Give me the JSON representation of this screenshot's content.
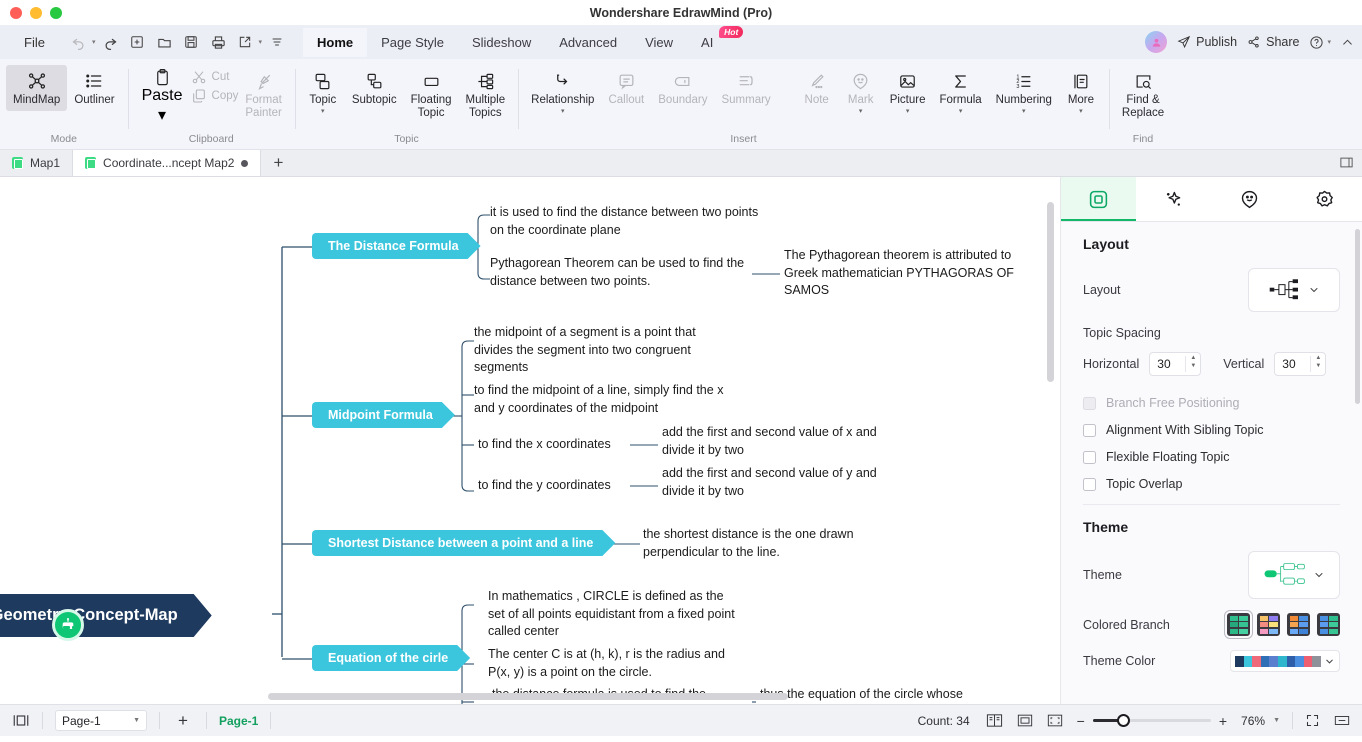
{
  "window": {
    "title": "Wondershare EdrawMind (Pro)",
    "traffic_lights": [
      "close",
      "minimize",
      "maximize"
    ]
  },
  "menubar": {
    "file_label": "File",
    "quick_access": [
      {
        "name": "undo-icon",
        "disabled": true
      },
      {
        "name": "redo-icon",
        "disabled": false
      },
      {
        "name": "new-icon",
        "disabled": false
      },
      {
        "name": "open-icon",
        "disabled": false
      },
      {
        "name": "save-icon",
        "disabled": false
      },
      {
        "name": "print-icon",
        "disabled": false
      },
      {
        "name": "export-icon",
        "disabled": false
      }
    ],
    "tabs": [
      {
        "label": "Home",
        "active": true
      },
      {
        "label": "Page Style",
        "active": false
      },
      {
        "label": "Slideshow",
        "active": false
      },
      {
        "label": "Advanced",
        "active": false
      },
      {
        "label": "View",
        "active": false
      },
      {
        "label": "AI",
        "active": false,
        "badge": "Hot"
      }
    ],
    "right": {
      "publish_label": "Publish",
      "share_label": "Share",
      "help_icon": "question-circle-icon",
      "collapse_icon": "chevron-up-icon"
    }
  },
  "ribbon": {
    "groups": [
      {
        "label": "Mode",
        "items": [
          {
            "label": "MindMap",
            "icon": "mindmap-icon",
            "selected": true,
            "disabled": false
          },
          {
            "label": "Outliner",
            "icon": "outliner-icon",
            "selected": false,
            "disabled": false
          }
        ]
      },
      {
        "label": "Clipboard",
        "items": [
          {
            "label": "Paste",
            "icon": "paste-icon",
            "dropdown": true,
            "disabled": false
          },
          {
            "label": "Cut",
            "icon": "scissors-icon",
            "disabled": true
          },
          {
            "label": "Copy",
            "icon": "copy-icon",
            "disabled": true
          },
          {
            "label": "Format\nPainter",
            "icon": "format-painter-icon",
            "disabled": true
          }
        ]
      },
      {
        "label": "Topic",
        "items": [
          {
            "label": "Topic",
            "icon": "topic-icon",
            "dropdown": true,
            "disabled": false
          },
          {
            "label": "Subtopic",
            "icon": "subtopic-icon",
            "disabled": false
          },
          {
            "label": "Floating\nTopic",
            "icon": "floating-topic-icon",
            "disabled": false
          },
          {
            "label": "Multiple\nTopics",
            "icon": "multiple-topics-icon",
            "disabled": false
          }
        ]
      },
      {
        "label": "Insert",
        "items": [
          {
            "label": "Relationship",
            "icon": "relationship-icon",
            "dropdown": true,
            "disabled": false
          },
          {
            "label": "Callout",
            "icon": "callout-icon",
            "disabled": true
          },
          {
            "label": "Boundary",
            "icon": "boundary-icon",
            "disabled": true
          },
          {
            "label": "Summary",
            "icon": "summary-icon",
            "disabled": true
          },
          {
            "label": "Note",
            "icon": "note-icon",
            "disabled": true
          },
          {
            "label": "Mark",
            "icon": "mark-icon",
            "dropdown": true,
            "disabled": true
          },
          {
            "label": "Picture",
            "icon": "picture-icon",
            "dropdown": true,
            "disabled": false
          },
          {
            "label": "Formula",
            "icon": "formula-icon",
            "dropdown": true,
            "disabled": false
          },
          {
            "label": "Numbering",
            "icon": "numbering-icon",
            "dropdown": true,
            "disabled": false
          },
          {
            "label": "More",
            "icon": "more-icon",
            "dropdown": true,
            "disabled": false
          }
        ]
      },
      {
        "label": "Find",
        "items": [
          {
            "label": "Find &\nReplace",
            "icon": "find-replace-icon",
            "disabled": false
          }
        ]
      }
    ]
  },
  "doctabs": {
    "tabs": [
      {
        "label": "Map1",
        "active": false,
        "modified": false
      },
      {
        "label": "Coordinate...ncept Map2",
        "active": true,
        "modified": true
      }
    ],
    "add_label": "+"
  },
  "mindmap": {
    "root": "e-Geometry-Concept-Map",
    "ai_icon": "ai-robot-icon",
    "branches": [
      {
        "title": "The Distance Formula",
        "children": [
          {
            "text": "it is used to find the distance between two points on the coordinate plane",
            "children": []
          },
          {
            "text": "Pythagorean Theorem can be used to find the distance between two points.",
            "children": [
              {
                "text": "The Pythagorean theorem is attributed to Greek mathematician PYTHAGORAS OF SAMOS"
              }
            ]
          }
        ]
      },
      {
        "title": "Midpoint Formula",
        "children": [
          {
            "text": "the midpoint of a segment is a point that divides the segment into two congruent segments",
            "children": []
          },
          {
            "text": "to find the midpoint of a line, simply find the x  and y coordinates of the midpoint",
            "children": []
          },
          {
            "text": "to find the x coordinates",
            "children": [
              {
                "text": "add the first and second value of x and divide it by two"
              }
            ]
          },
          {
            "text": "to find the y coordinates",
            "children": [
              {
                "text": "add the first and second value of y and divide it by two"
              }
            ]
          }
        ]
      },
      {
        "title": "Shortest Distance between a point and a line",
        "children": [
          {
            "text": "the shortest distance is the one drawn perpendicular to the line.",
            "children": []
          }
        ]
      },
      {
        "title": "Equation of the cirle",
        "children": [
          {
            "text": "In mathematics , CIRCLE is defined as the set of all points equidistant from a fixed point called center",
            "children": []
          },
          {
            "text": "The center C is at (h, k), r is the radius and P(x, y) is a point on the circle.",
            "children": []
          },
          {
            "text": "the distance formula is used to find the",
            "children": [
              {
                "text": "thus the equation of the circle whose"
              }
            ]
          }
        ]
      }
    ]
  },
  "panel": {
    "tabs": [
      {
        "icon": "layout-panel-icon",
        "active": true
      },
      {
        "icon": "ai-sparkle-icon",
        "active": false
      },
      {
        "icon": "smiley-icon",
        "active": false
      },
      {
        "icon": "gear-icon",
        "active": false
      }
    ],
    "layout_section": {
      "heading": "Layout",
      "layout_label": "Layout",
      "layout_value_icon": "tree-right-layout-icon",
      "topic_spacing_label": "Topic Spacing",
      "horizontal_label": "Horizontal",
      "horizontal_value": "30",
      "vertical_label": "Vertical",
      "vertical_value": "30",
      "checkboxes": [
        {
          "label": "Branch Free Positioning",
          "checked": false,
          "disabled": true
        },
        {
          "label": "Alignment With Sibling Topic",
          "checked": false,
          "disabled": false
        },
        {
          "label": "Flexible Floating Topic",
          "checked": false,
          "disabled": false
        },
        {
          "label": "Topic Overlap",
          "checked": false,
          "disabled": false
        }
      ]
    },
    "theme_section": {
      "heading": "Theme",
      "theme_label": "Theme",
      "theme_preview_icon": "theme-preview-icon",
      "colored_branch_label": "Colored Branch",
      "colored_branch_options": [
        {
          "name": "green-palette",
          "selected": true,
          "colors": [
            "#2fbf8f",
            "#3ecb9a",
            "#24a87c",
            "#37c493",
            "#2bb887",
            "#45d0a2"
          ]
        },
        {
          "name": "pastel-palette",
          "selected": false,
          "colors": [
            "#f6c36a",
            "#f28b82",
            "#8e7cf0",
            "#f9e07a",
            "#f59ac0",
            "#7bb8f5"
          ]
        },
        {
          "name": "orange-blue-palette",
          "selected": false,
          "colors": [
            "#f08a36",
            "#f5a34f",
            "#4a90e2",
            "#5b9bf0",
            "#6aa9f5",
            "#3f83d8"
          ]
        },
        {
          "name": "blue-green-palette",
          "selected": false,
          "colors": [
            "#4a90e2",
            "#5b9bf0",
            "#2fbf8f",
            "#3ecb9a",
            "#4a90e2",
            "#37c493"
          ]
        }
      ],
      "theme_color_label": "Theme Color",
      "theme_color_swatches": [
        "#1e3a5f",
        "#3cc6dd",
        "#ef6b7a",
        "#2f6fb5",
        "#5b7fcf",
        "#2fb5cc",
        "#2f5fa8",
        "#4a8ee0",
        "#ef5f72",
        "#8f9298"
      ]
    }
  },
  "statusbar": {
    "view_icon": "page-view-icon",
    "page_select_value": "Page-1",
    "add_page_label": "+",
    "active_page": "Page-1",
    "count_label": "Count: 34",
    "icons": [
      "split-view-icon",
      "fit-page-icon",
      "fullscreen-icon"
    ],
    "zoom_minus": "−",
    "zoom_plus": "+",
    "zoom_value": "76%",
    "right_icons": [
      "fit-screen-icon",
      "fit-width-icon"
    ]
  }
}
